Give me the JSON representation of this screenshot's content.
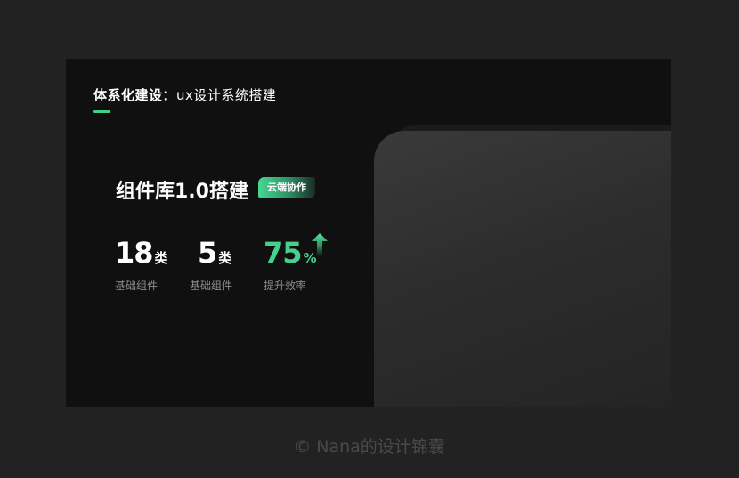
{
  "header": {
    "title_bold": "体系化建设：",
    "title_rest": "ux设计系统搭建",
    "underline_color": "#3fd18a"
  },
  "section": {
    "title": "组件库1.0搭建",
    "tag": "云端协作"
  },
  "stats": [
    {
      "value": "18",
      "unit": "类",
      "label": "基础组件"
    },
    {
      "value": "5",
      "unit": "类",
      "label": "基础组件"
    },
    {
      "value": "75",
      "unit": "%",
      "label": "提升效率",
      "accent": "#45d08f",
      "icon": "up-arrow-icon"
    }
  ],
  "footer": {
    "text": "© Nana的设计锦囊"
  }
}
